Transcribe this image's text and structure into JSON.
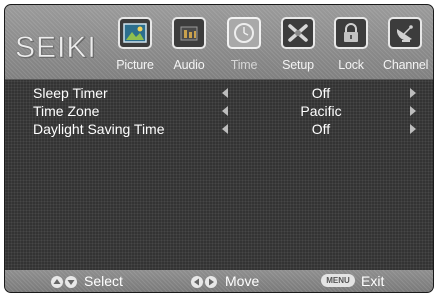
{
  "brand": {
    "logo_text": "SEIKI"
  },
  "tabs": [
    {
      "label": "Picture",
      "icon": "picture-icon",
      "active": false
    },
    {
      "label": "Audio",
      "icon": "audio-icon",
      "active": false
    },
    {
      "label": "Time",
      "icon": "time-icon",
      "active": true
    },
    {
      "label": "Setup",
      "icon": "setup-icon",
      "active": false
    },
    {
      "label": "Lock",
      "icon": "lock-icon",
      "active": false
    },
    {
      "label": "Channel",
      "icon": "channel-icon",
      "active": false
    }
  ],
  "settings": [
    {
      "label": "Sleep Timer",
      "value": "Off"
    },
    {
      "label": "Time Zone",
      "value": "Pacific"
    },
    {
      "label": "Daylight Saving Time",
      "value": "Off"
    }
  ],
  "help": {
    "select_label": "Select",
    "move_label": "Move",
    "menu_key": "MENU",
    "exit_label": "Exit"
  },
  "colors": {
    "panel": "#333333",
    "bar": "#8a8a8a",
    "text": "#ffffff",
    "active_tab": "#a9a9a9"
  }
}
